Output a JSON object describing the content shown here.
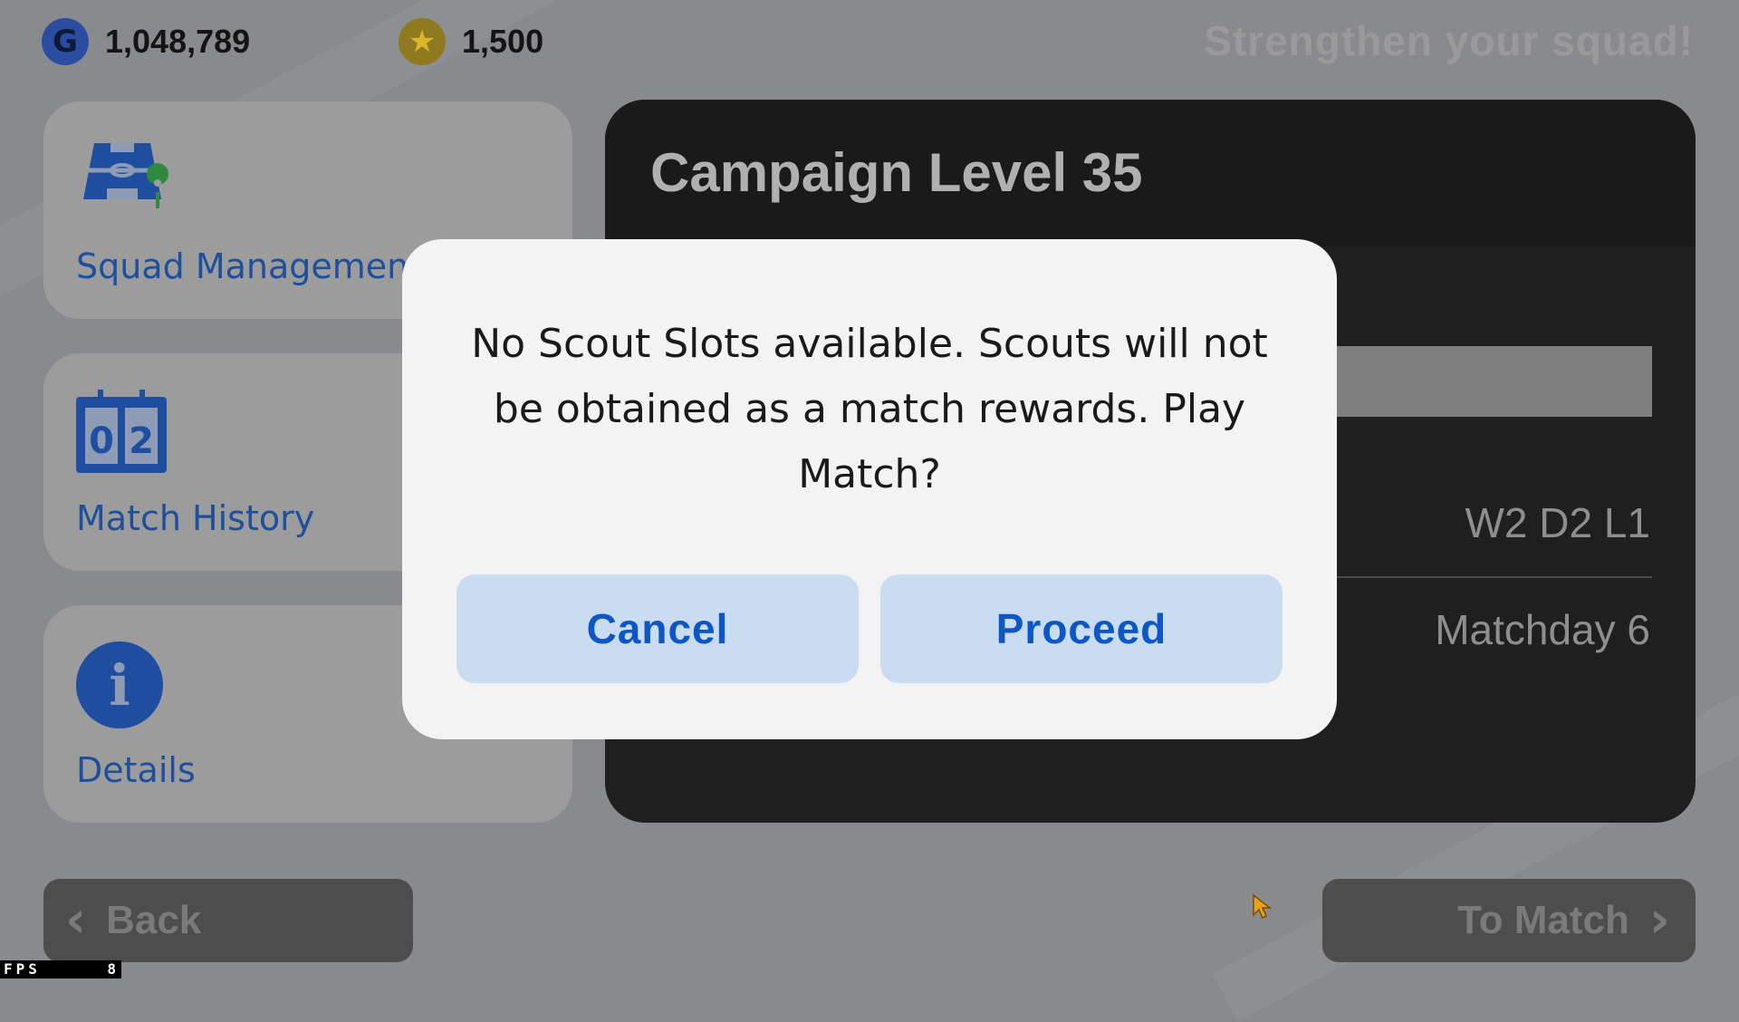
{
  "top_bar": {
    "gp_icon": "g-coin-icon",
    "gp_icon_glyph": "G",
    "gp_amount": "1,048,789",
    "coin_icon": "star-coin-icon",
    "coin_amount": "1,500",
    "hint": "Strengthen your squad!"
  },
  "menu": {
    "items": [
      {
        "label": "Squad Management",
        "icon": "pitch-icon"
      },
      {
        "label": "Match History",
        "icon": "scoreboard-icon",
        "score": [
          "0",
          "2"
        ]
      },
      {
        "label": "Details",
        "icon": "info-icon",
        "glyph": "i"
      }
    ]
  },
  "campaign": {
    "title": "Campaign Level 35",
    "record": "W2 D2 L1",
    "matchday": "Matchday 6"
  },
  "bottom": {
    "back_label": "Back",
    "to_match_label": "To Match"
  },
  "fps": {
    "label": "FPS",
    "value": "8"
  },
  "dialog": {
    "message": "No Scout Slots available. Scouts will not be obtained as a match rewards. Play Match?",
    "cancel_label": "Cancel",
    "proceed_label": "Proceed"
  },
  "colors": {
    "accent_blue": "#0d56c8",
    "dialog_button_bg": "#c9dcf2",
    "menu_label": "#1d4f9c"
  }
}
